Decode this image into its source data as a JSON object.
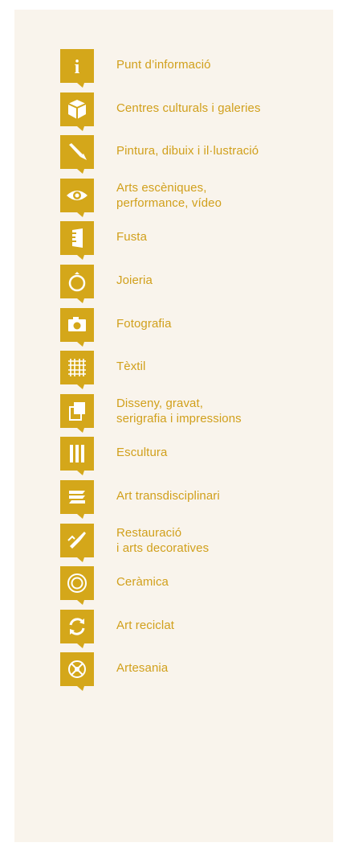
{
  "brand_color": "#d4a71a",
  "background": "#f9f4ec",
  "items": [
    {
      "icon": "info-icon",
      "line1": "Punt d’informació",
      "line2": ""
    },
    {
      "icon": "cube-icon",
      "line1": "Centres culturals i galeries",
      "line2": ""
    },
    {
      "icon": "paintbrush-icon",
      "line1": "Pintura, dibuix i il·lustració",
      "line2": ""
    },
    {
      "icon": "eye-icon",
      "line1": "Arts escèniques,",
      "line2": "performance, vídeo"
    },
    {
      "icon": "wood-plank-icon",
      "line1": "Fusta",
      "line2": ""
    },
    {
      "icon": "ring-icon",
      "line1": "Joieria",
      "line2": ""
    },
    {
      "icon": "camera-icon",
      "line1": "Fotografia",
      "line2": ""
    },
    {
      "icon": "textile-icon",
      "line1": "Tèxtil",
      "line2": ""
    },
    {
      "icon": "layers-icon",
      "line1": "Disseny, gravat,",
      "line2": "serigrafia i impressions"
    },
    {
      "icon": "columns-icon",
      "line1": "Escultura",
      "line2": ""
    },
    {
      "icon": "stack-icon",
      "line1": "Art transdisciplinari",
      "line2": ""
    },
    {
      "icon": "restoration-brush-icon",
      "line1": "Restauració",
      "line2": "i arts decoratives"
    },
    {
      "icon": "ceramic-circle-icon",
      "line1": "Ceràmica",
      "line2": ""
    },
    {
      "icon": "recycle-icon",
      "line1": "Art reciclat",
      "line2": ""
    },
    {
      "icon": "craft-wheel-icon",
      "line1": "Artesania",
      "line2": ""
    }
  ]
}
